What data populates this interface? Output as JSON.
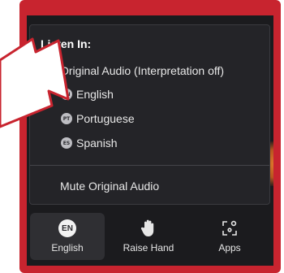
{
  "menu": {
    "heading": "Listen In:",
    "original_audio": "Original Audio (Interpretation off)",
    "languages": [
      {
        "badge": "EN",
        "label": "English"
      },
      {
        "badge": "PT",
        "label": "Portuguese"
      },
      {
        "badge": "ES",
        "label": "Spanish"
      }
    ],
    "mute_original": "Mute Original Audio"
  },
  "toolbar": {
    "items": [
      {
        "icon": "EN",
        "label": "English",
        "active": true
      },
      {
        "icon": "hand-icon",
        "label": "Raise Hand"
      },
      {
        "icon": "apps-icon",
        "label": "Apps"
      }
    ]
  },
  "colors": {
    "frame": "#c8242f",
    "menu_bg": "#242428",
    "screen_bg": "#1b1b1e",
    "arrow_fill": "#ffffff"
  }
}
